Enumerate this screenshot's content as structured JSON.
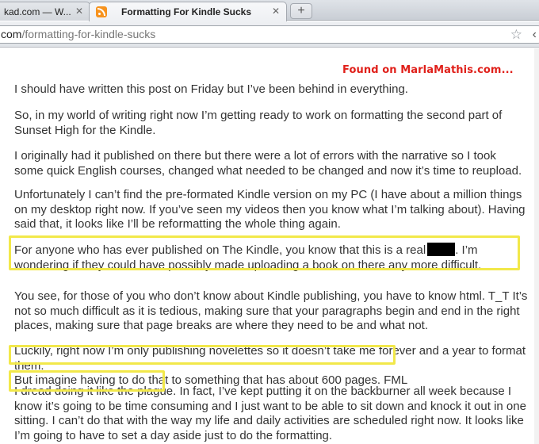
{
  "browser": {
    "tabs": [
      {
        "title": "kad.com — W...",
        "active": false
      },
      {
        "title": "Formatting For Kindle Sucks",
        "active": true
      }
    ],
    "close_glyph": "✕",
    "new_tab_glyph": "+",
    "address": {
      "host": "com",
      "path": "/formatting-for-kindle-sucks"
    },
    "icons": [
      "rss-icon",
      "close-icon",
      "new-tab-icon",
      "star-icon",
      "chevron-left-icon"
    ]
  },
  "page": {
    "watermark": "Found on MarlaMathis.com...",
    "paragraphs": {
      "p1": "I should have written this post on Friday but I’ve been behind in everything.",
      "p2": "So, in my world of writing right now I’m getting ready to work on formatting the second part of Sunset High for the Kindle.",
      "p3": "I originally had it published on there but there were a lot of errors with the narrative so I took some quick English courses, changed what needed to be changed and now it’s time to reupload.",
      "p4": "Unfortunately I can’t find the pre-formated Kindle version on my PC (I have about a million things on my desktop right now. If you’ve seen my videos then you know what I’m talking about). Having said that, it looks like I’ll be reformatting the whole thing again.",
      "p5a": "For anyone who has ever published on The Kindle, you know that this is a real",
      "p5b": ". I’m wondering if they could have possibly made uploading a book on there any more difficult.",
      "p6": "You see, for those of you who don’t know about Kindle publishing, you have to know html. T_T It’s not so much difficult as it is tedious, making sure that your paragraphs begin and end in the right places, making sure that page breaks are where they need to be and what not.",
      "p7a": "Luckily, right now I’m only publishing novelettes so it doesn’t take me forever and a year to format them.",
      "p7b": "But imagine having to do that to something that has about 600 pages. FML",
      "p8a": "I dread doing it like the plague.",
      "p8b": " In fact, I’ve kept putting it on the backburner all week because I know it’s going to be time consuming and I just want to be able to sit down and knock it out in one sitting. I can’t do that with the way my life and daily activities are scheduled right now. It looks like I’m going to have to set a day aside just to do the formatting."
    }
  },
  "colors": {
    "highlight": "#f2e84a",
    "watermark": "#e0201a",
    "rss": "#f7931e",
    "text": "#333333"
  }
}
